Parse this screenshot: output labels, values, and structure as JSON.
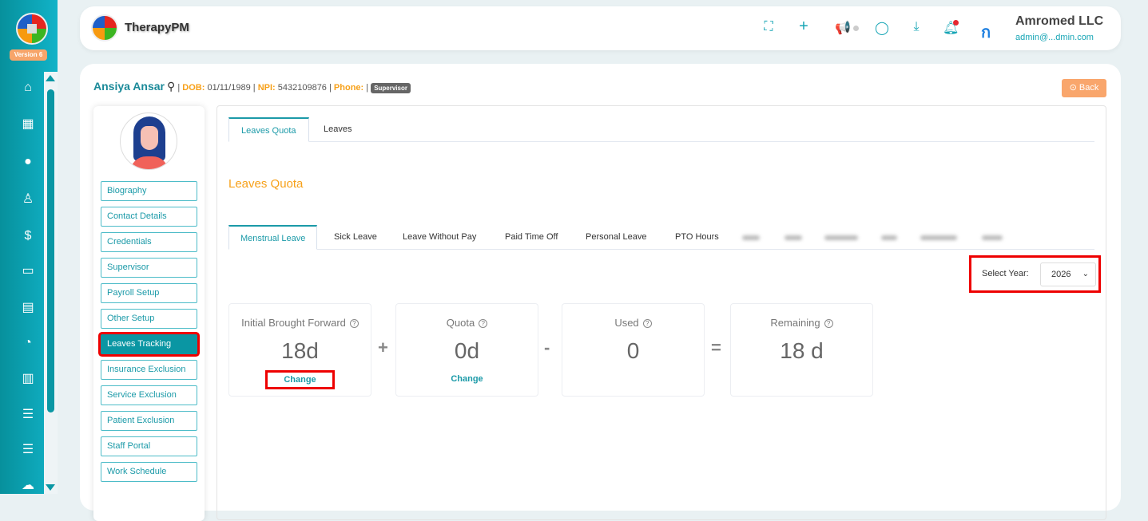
{
  "app": {
    "version": "Version 6",
    "name": "TherapyPM"
  },
  "sidebar": {
    "icons": [
      "home-icon",
      "calendar-icon",
      "patient-icon",
      "staff-icon",
      "billing-icon",
      "payment-card-icon",
      "report-file-icon",
      "clock-icon",
      "chart-icon",
      "menu-icon",
      "menu-icon",
      "upload-cloud-icon"
    ]
  },
  "header": {
    "org": "Amromed LLC",
    "email": "admin@...dmin.com"
  },
  "patient": {
    "name": "Ansiya Ansar",
    "dob_label": "DOB:",
    "dob": "01/11/1989",
    "npi_label": "NPI:",
    "npi": "5432109876",
    "phone_label": "Phone:",
    "phone": "",
    "role": "Supervisor"
  },
  "back_label": "Back",
  "profile_menu": [
    "Biography",
    "Contact Details",
    "Credentials",
    "Supervisor",
    "Payroll Setup",
    "Other Setup",
    "Leaves Tracking",
    "Insurance Exclusion",
    "Service Exclusion",
    "Patient Exclusion",
    "Staff Portal",
    "Work Schedule"
  ],
  "tabs": [
    "Leaves Quota",
    "Leaves"
  ],
  "section_title": "Leaves Quota",
  "leave_tabs": [
    "Menstrual Leave",
    "Sick Leave",
    "Leave Without Pay",
    "Paid Time Off",
    "Personal Leave",
    "PTO Hours"
  ],
  "year": {
    "label": "Select Year:",
    "value": "2026"
  },
  "cards": [
    {
      "title": "Initial Brought Forward",
      "value": "18d",
      "action": "Change"
    },
    {
      "title": "Quota",
      "value": "0d",
      "action": "Change"
    },
    {
      "title": "Used",
      "value": "0"
    },
    {
      "title": "Remaining",
      "value": "18 d"
    }
  ],
  "operators": [
    "+",
    "-",
    "="
  ]
}
